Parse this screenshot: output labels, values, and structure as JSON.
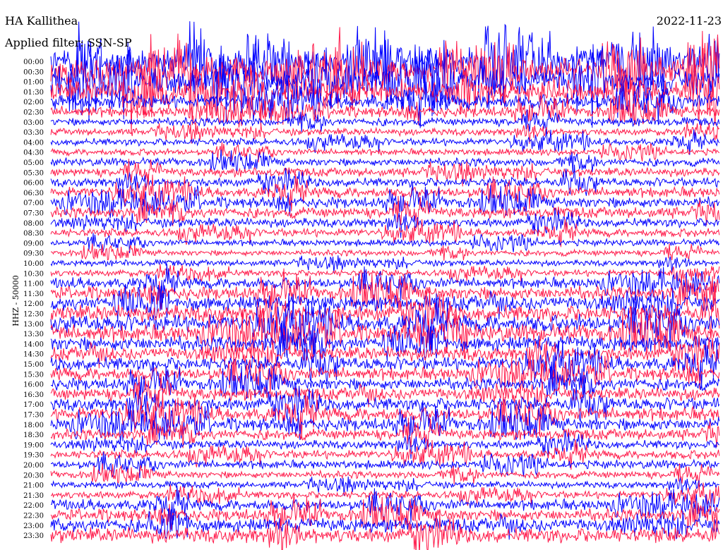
{
  "header": {
    "station": "HA Kallithea",
    "date": "2022-11-23",
    "filter": "Applied filter: SSN-SP"
  },
  "chart_data": {
    "type": "line",
    "title": "HA Kallithea",
    "date": "2022-11-23",
    "ylabel": "HHZ - 50000",
    "row_labels": [
      "00:00",
      "00:30",
      "01:00",
      "01:30",
      "02:00",
      "02:30",
      "03:00",
      "03:30",
      "04:00",
      "04:30",
      "05:00",
      "05:30",
      "06:00",
      "06:30",
      "07:00",
      "07:30",
      "08:00",
      "08:30",
      "09:00",
      "09:30",
      "10:00",
      "10:30",
      "11:00",
      "11:30",
      "12:00",
      "12:30",
      "13:00",
      "13:30",
      "14:00",
      "14:30",
      "15:00",
      "15:30",
      "16:00",
      "16:30",
      "17:00",
      "17:30",
      "18:00",
      "18:30",
      "19:00",
      "19:30",
      "20:00",
      "20:30",
      "21:00",
      "21:30",
      "22:00",
      "22:30",
      "23:00",
      "23:30"
    ],
    "row_activity": [
      1.0,
      0.95,
      0.9,
      0.75,
      0.45,
      0.3,
      0.18,
      0.14,
      0.15,
      0.12,
      0.18,
      0.2,
      0.22,
      0.28,
      0.3,
      0.28,
      0.22,
      0.18,
      0.12,
      0.1,
      0.1,
      0.12,
      0.3,
      0.4,
      0.45,
      0.5,
      0.55,
      0.55,
      0.45,
      0.4,
      0.4,
      0.38,
      0.35,
      0.35,
      0.38,
      0.4,
      0.38,
      0.28,
      0.2,
      0.2,
      0.2,
      0.15,
      0.12,
      0.15,
      0.3,
      0.35,
      0.4,
      0.45
    ],
    "colors": {
      "even": "#0000ff",
      "odd": "#ff1a4a"
    },
    "grid": false
  }
}
